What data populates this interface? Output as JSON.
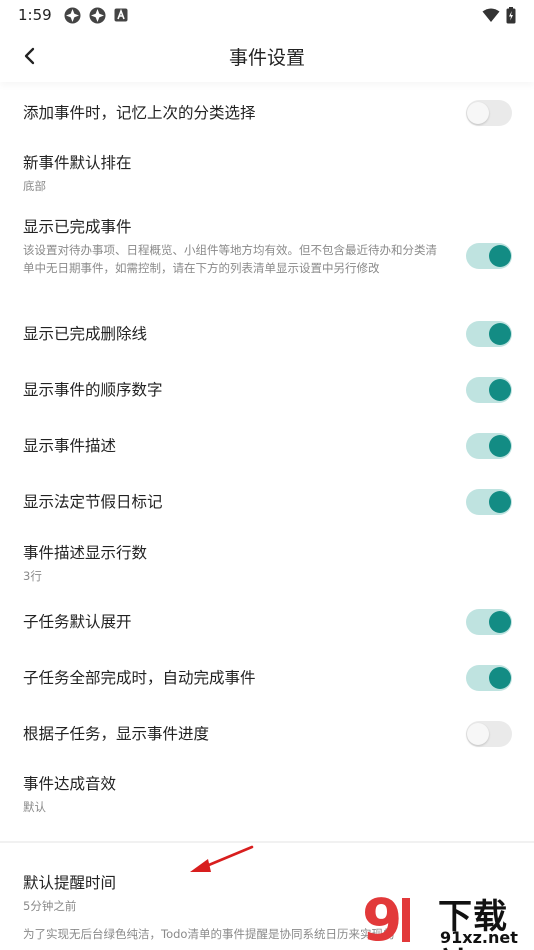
{
  "status_bar": {
    "time": "1:59",
    "left_icons": [
      "notification-icon",
      "notification-icon",
      "accessibility-icon"
    ],
    "right_icons": [
      "wifi-icon",
      "battery-charging-icon"
    ]
  },
  "app_bar": {
    "title": "事件设置",
    "back_icon": "chevron-left-icon"
  },
  "settings": [
    {
      "id": "remember-category",
      "title": "添加事件时，记忆上次的分类选择",
      "control": "toggle",
      "enabled": false
    },
    {
      "id": "default-position",
      "title": "新事件默认排在",
      "subtitle": "底部",
      "control": "value"
    },
    {
      "id": "show-completed",
      "title": "显示已完成事件",
      "subtitle": "该设置对待办事项、日程概览、小组件等地方均有效。但不包含最近待办和分类清单中无日期事件，如需控制，请在下方的列表清单显示设置中另行修改",
      "control": "toggle",
      "enabled": true
    },
    {
      "id": "show-strikethrough",
      "title": "显示已完成删除线",
      "control": "toggle",
      "enabled": true
    },
    {
      "id": "show-order-number",
      "title": "显示事件的顺序数字",
      "control": "toggle",
      "enabled": true
    },
    {
      "id": "show-description",
      "title": "显示事件描述",
      "control": "toggle",
      "enabled": true
    },
    {
      "id": "show-holiday",
      "title": "显示法定节假日标记",
      "control": "toggle",
      "enabled": true
    },
    {
      "id": "description-lines",
      "title": "事件描述显示行数",
      "subtitle": "3行",
      "control": "value"
    },
    {
      "id": "subtask-expand",
      "title": "子任务默认展开",
      "control": "toggle",
      "enabled": true
    },
    {
      "id": "subtask-auto-complete",
      "title": "子任务全部完成时，自动完成事件",
      "control": "toggle",
      "enabled": true
    },
    {
      "id": "subtask-progress",
      "title": "根据子任务，显示事件进度",
      "control": "toggle",
      "enabled": false
    },
    {
      "id": "complete-sound",
      "title": "事件达成音效",
      "subtitle": "默认",
      "control": "value"
    },
    {
      "id": "default-reminder",
      "title": "默认提醒时间",
      "subtitle": "5分钟之前",
      "note": "为了实现无后台绿色纯洁，Todo清单的事件提醒是协同系统日历来实现的",
      "control": "value"
    }
  ],
  "colors": {
    "accent": "#138c84",
    "track_on": "#bfe3e0",
    "track_off": "#eaeaea",
    "arrow": "#d81e1e",
    "watermark": "#e2393a"
  },
  "watermark": {
    "brand": "下载站",
    "url": "91xz.net",
    "mark": "9"
  }
}
